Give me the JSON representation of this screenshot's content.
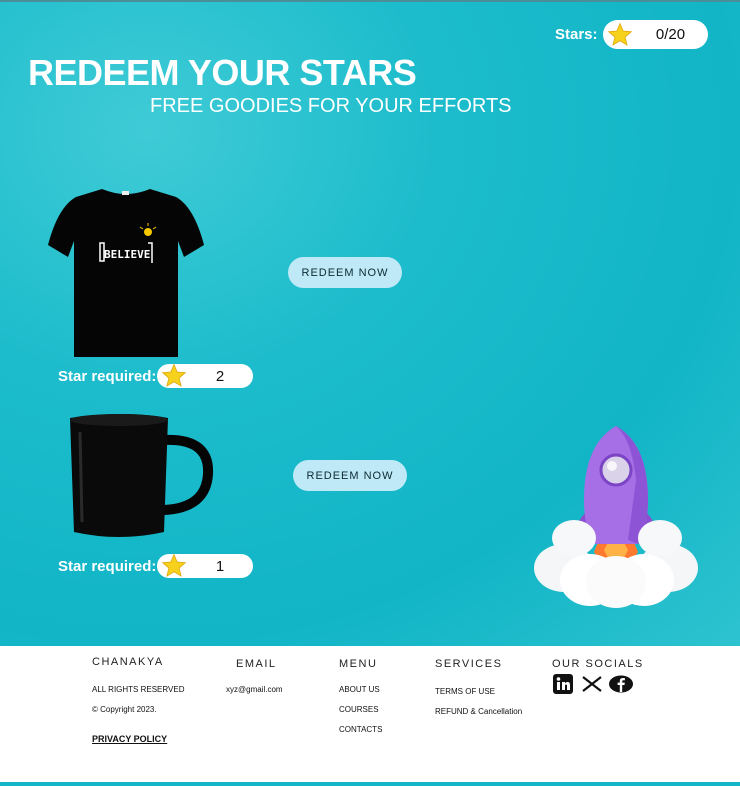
{
  "header": {
    "title": "REDEEM YOUR STARS",
    "subtitle": "FREE GOODIES FOR YOUR EFFORTS",
    "stars_label": "Stars:",
    "stars_value": "0/20"
  },
  "items": [
    {
      "name": "T-shirt",
      "print_text": "BELIEVE",
      "star_label": "Star required:",
      "stars_required": "2",
      "button": "REDEEM NOW"
    },
    {
      "name": "Mug",
      "star_label": "Star required:",
      "stars_required": "1",
      "button": "REDEEM NOW"
    }
  ],
  "footer": {
    "brand": "CHANAKYA",
    "rights": "ALL RIGHTS RESERVED",
    "copyright": "© Copyright 2023.",
    "privacy": "PRIVACY POLICY",
    "email_head": "EMAIL",
    "email": "xyz@gmail.com",
    "menu_head": "MENU",
    "menu": [
      "ABOUT US",
      "COURSES",
      "CONTACTS"
    ],
    "services_head": "SERVICES",
    "services": [
      "TERMS OF USE",
      "REFUND & Cancellation"
    ],
    "socials_head": "OUR SOCIALS",
    "socials": [
      "linkedin-icon",
      "x-icon",
      "facebook-icon"
    ]
  },
  "colors": {
    "accent": "#14b6c7",
    "button": "#bfe9f6",
    "star": "#f7d21c"
  }
}
